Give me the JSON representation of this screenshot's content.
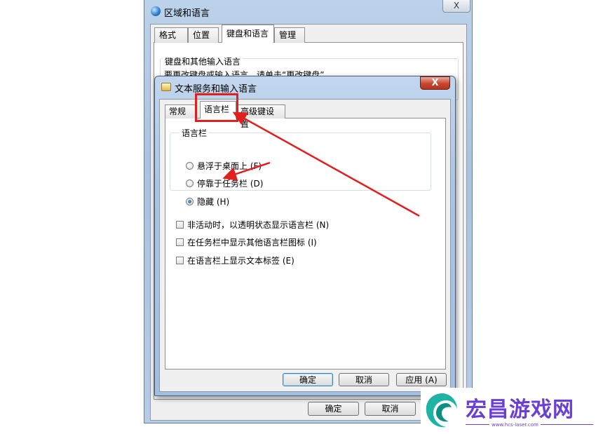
{
  "back_window": {
    "title": "区域和语言",
    "close_label": "X",
    "tabs": [
      "格式",
      "位置",
      "键盘和语言",
      "管理"
    ],
    "group_title": "键盘和其他输入语言",
    "group_desc": "要更改键盘或输入语言，请单击“更改键盘”",
    "ok_label": "确定",
    "cancel_label": "取消"
  },
  "dialog": {
    "title": "文本服务和输入语言",
    "close_label": "X",
    "tabs": [
      "常规",
      "语言栏",
      "高级键设置"
    ],
    "langbar_group_title": "语言栏",
    "radios": [
      "悬浮于桌面上 (F)",
      "停靠于任务栏 (D)",
      "隐藏 (H)"
    ],
    "selected_radio": 2,
    "checkboxes": [
      "非活动时，以透明状态显示语言栏 (N)",
      "在任务栏中显示其他语言栏图标 (I)",
      "在语言栏上显示文本标签 (E)"
    ],
    "ok_label": "确定",
    "cancel_label": "取消",
    "apply_label": "应用 (A)"
  },
  "watermark": {
    "title": "宏昌游戏网",
    "url": "www.hcs-laser.com"
  },
  "colors": {
    "annotation": "#e0201f",
    "watermark": "#6a3fd4",
    "logo_teal": "#1fb3a6"
  }
}
